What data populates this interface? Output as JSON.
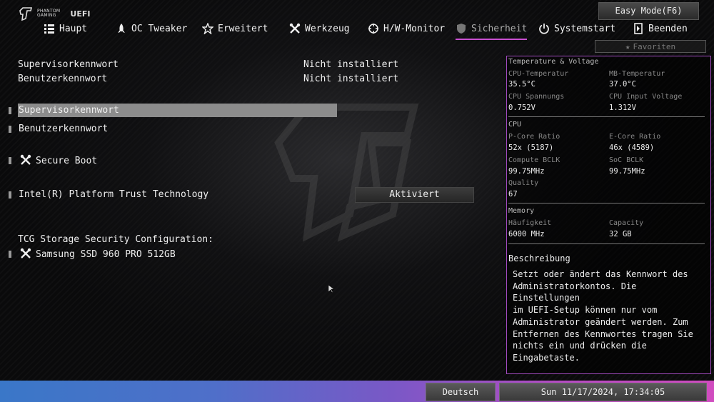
{
  "header": {
    "logo_text": [
      "PHANTOM",
      "GAMING"
    ],
    "uefi": "UEFI",
    "easy_mode": "Easy Mode(F6)",
    "favorites": "Favoriten"
  },
  "tabs": [
    {
      "label": "Haupt",
      "icon": "list-icon"
    },
    {
      "label": "OC Tweaker",
      "icon": "rocket-icon"
    },
    {
      "label": "Erweitert",
      "icon": "star-icon"
    },
    {
      "label": "Werkzeug",
      "icon": "tools-icon"
    },
    {
      "label": "H/W-Monitor",
      "icon": "target-icon"
    },
    {
      "label": "Sicherheit",
      "icon": "shield-icon",
      "active": true
    },
    {
      "label": "Systemstart",
      "icon": "power-icon"
    },
    {
      "label": "Beenden",
      "icon": "exit-icon"
    }
  ],
  "status": {
    "supervisor_label": "Supervisorkennwort",
    "supervisor_value": "Nicht installiert",
    "user_label": "Benutzerkennwort",
    "user_value": "Nicht installiert"
  },
  "items": {
    "supervisor": "Supervisorkennwort",
    "user": "Benutzerkennwort",
    "secure_boot": "Secure Boot",
    "ptt_label": "Intel(R) Platform Trust Technology",
    "ptt_value": "Aktiviert",
    "tcg_heading": "TCG Storage Security Configuration:",
    "ssd": "Samsung SSD 960 PRO 512GB"
  },
  "monitor": {
    "tv_title": "Temperature & Voltage",
    "cpu_temp_label": "CPU-Temperatur",
    "cpu_temp_value": "35.5°C",
    "mb_temp_label": "MB-Temperatur",
    "mb_temp_value": "37.0°C",
    "cpu_volt_label": "CPU Spannungs",
    "cpu_volt_value": "0.752V",
    "cpu_input_label": "CPU Input Voltage",
    "cpu_input_value": "1.312V",
    "cpu_title": "CPU",
    "pcore_label": "P-Core Ratio",
    "pcore_value": "52x (5187)",
    "ecore_label": "E-Core Ratio",
    "ecore_value": "46x (4589)",
    "bclk_label": "Compute BCLK",
    "bclk_value": "99.75MHz",
    "soc_label": "SoC BCLK",
    "soc_value": "99.75MHz",
    "quality_label": "Quality",
    "quality_value": "67",
    "mem_title": "Memory",
    "freq_label": "Häufigkeit",
    "freq_value": "6000 MHz",
    "cap_label": "Capacity",
    "cap_value": "32 GB"
  },
  "description": {
    "title": "Beschreibung",
    "text": "Setzt oder ändert das Kennwort des\nAdministratorkontos. Die Einstellungen\nim UEFI-Setup können nur vom\nAdministrator geändert werden. Zum\nEntfernen des Kennwortes tragen Sie\nnichts ein und drücken die\nEingabetaste."
  },
  "footer": {
    "language": "Deutsch",
    "datetime": "Sun 11/17/2024, 17:34:05"
  },
  "colors": {
    "accent": "#c94fd1",
    "panel_border": "#a14bbf",
    "selection": "#8c8c8c"
  }
}
